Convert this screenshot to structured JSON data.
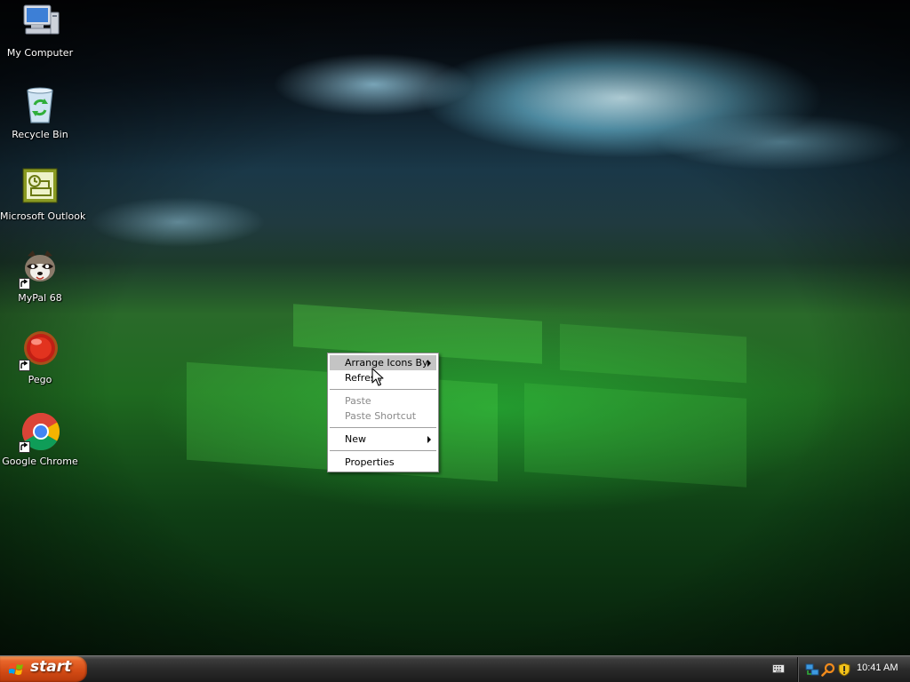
{
  "desktop": {
    "wallpaper": "dark-stormy-sky-over-green-hills-windows-logo",
    "icons": [
      {
        "label": "My Computer",
        "icon": "computer-icon"
      },
      {
        "label": "Recycle Bin",
        "icon": "recycle-bin-icon"
      },
      {
        "label": "Microsoft Outlook",
        "icon": "outlook-icon"
      },
      {
        "label": "MyPal 68",
        "icon": "mypal-raccoon-icon",
        "shortcut": true
      },
      {
        "label": "Pego",
        "icon": "pego-red-circle-icon",
        "shortcut": true
      },
      {
        "label": "Google Chrome",
        "icon": "chrome-icon",
        "shortcut": true
      }
    ]
  },
  "context_menu": {
    "items": [
      {
        "label": "Arrange Icons By",
        "submenu": true,
        "highlighted": true
      },
      {
        "label": "Refresh"
      },
      {
        "label": "Paste",
        "disabled": true
      },
      {
        "label": "Paste Shortcut",
        "disabled": true
      },
      {
        "label": "New",
        "submenu": true
      },
      {
        "label": "Properties"
      }
    ]
  },
  "taskbar": {
    "start_label": "start",
    "quick_icons": [
      "keyboard-icon"
    ],
    "tray_icons": [
      "network-icon",
      "search-icon",
      "security-shield-icon"
    ],
    "clock": "10:41 AM"
  },
  "colors": {
    "start_button": "#d24a14",
    "taskbar": "#2a2a2a",
    "menu_highlight": "#c4c4c4"
  }
}
